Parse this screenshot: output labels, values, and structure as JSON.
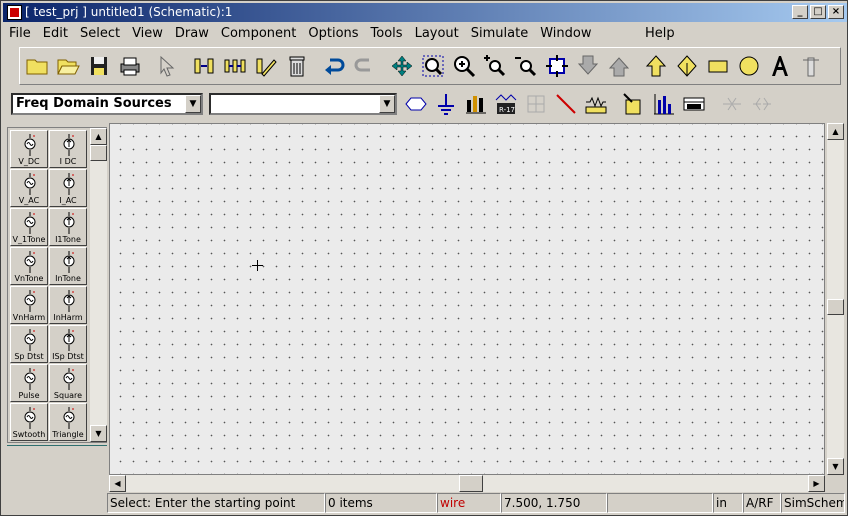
{
  "window": {
    "title": "[ test_prj ] untitled1 (Schematic):1"
  },
  "menu": [
    "File",
    "Edit",
    "Select",
    "View",
    "Draw",
    "Component",
    "Options",
    "Tools",
    "Layout",
    "Simulate",
    "Window"
  ],
  "menu_help": "Help",
  "toolbar1": [
    "new-icon",
    "open-icon",
    "save-icon",
    "print-icon",
    "select-arrow-icon",
    "insert-component-icon",
    "component-library-icon",
    "edit-parameters-icon",
    "delete-icon",
    "undo-icon",
    "redo-icon",
    "move-icon",
    "zoom-area-icon",
    "zoom-in-icon",
    "zoom-plus-icon",
    "zoom-minus-icon",
    "fit-view-icon",
    "push-down-icon",
    "pop-up-icon",
    "pin-icon",
    "port-icon",
    "rectangle-icon",
    "circle-icon",
    "text-icon",
    "wire-label-icon"
  ],
  "palette_selector": {
    "value": "Freq Domain Sources"
  },
  "component_selector": {
    "value": ""
  },
  "toolbar2": [
    "hexagon-icon",
    "ground-icon",
    "var-eqn-icon",
    "display-icon",
    "wire-icon",
    "resistor-icon",
    "probe-icon",
    "bar-chart-icon",
    "s-params-icon",
    "mirror-icon",
    "rotate-icon"
  ],
  "palette": [
    {
      "label": "V_DC",
      "icon": "v-dc-icon"
    },
    {
      "label": "I DC",
      "icon": "i-dc-icon"
    },
    {
      "label": "V_AC",
      "icon": "v-ac-icon"
    },
    {
      "label": "I_AC",
      "icon": "i-ac-icon"
    },
    {
      "label": "V_1Tone",
      "icon": "v-1tone-icon"
    },
    {
      "label": "I1Tone",
      "icon": "i-1tone-icon"
    },
    {
      "label": "VnTone",
      "icon": "v-ntone-icon"
    },
    {
      "label": "InTone",
      "icon": "i-ntone-icon"
    },
    {
      "label": "VnHarm",
      "icon": "v-nharm-icon"
    },
    {
      "label": "InHarm",
      "icon": "i-nharm-icon"
    },
    {
      "label": "Sp Dtst",
      "icon": "v-sp-dtst-icon"
    },
    {
      "label": "ISp Dtst",
      "icon": "i-sp-dtst-icon"
    },
    {
      "label": "Pulse",
      "icon": "pulse-icon"
    },
    {
      "label": "Square",
      "icon": "square-icon"
    },
    {
      "label": "Swtooth",
      "icon": "sawtooth-icon"
    },
    {
      "label": "Triangle",
      "icon": "triangle-icon"
    }
  ],
  "status": {
    "prompt": "Select: Enter the starting point",
    "items": "0 items",
    "mode": "wire",
    "coords": "7.500, 1.750",
    "blank": "",
    "units": "in",
    "domain": "A/RF",
    "app": "SimSchem"
  },
  "colors": {
    "mode_text": "#c00000",
    "title_start": "#0a246a",
    "title_end": "#a6caf0",
    "canvas": "#ebebeb"
  }
}
